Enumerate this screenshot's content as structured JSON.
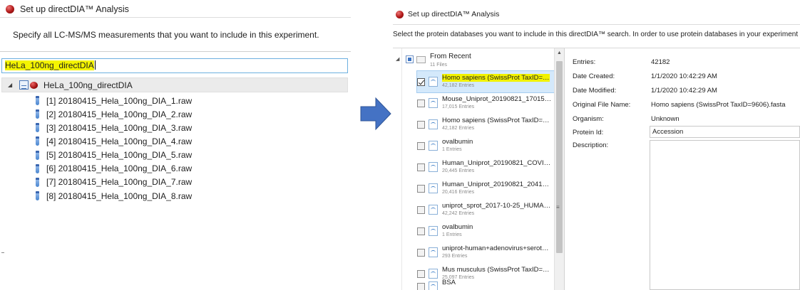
{
  "left": {
    "title": "Set up directDIA™ Analysis",
    "instruction": "Specify all LC-MS/MS measurements that you want to include in this experiment.",
    "experiment_name": "HeLa_100ng_directDIA",
    "tree_root": "HeLa_100ng_directDIA",
    "files": [
      "[1] 20180415_Hela_100ng_DIA_1.raw",
      "[2] 20180415_Hela_100ng_DIA_2.raw",
      "[3] 20180415_Hela_100ng_DIA_3.raw",
      "[4] 20180415_Hela_100ng_DIA_4.raw",
      "[5] 20180415_Hela_100ng_DIA_5.raw",
      "[6] 20180415_Hela_100ng_DIA_6.raw",
      "[7] 20180415_Hela_100ng_DIA_7.raw",
      "[8] 20180415_Hela_100ng_DIA_8.raw"
    ]
  },
  "right": {
    "title": "Set up directDIA™ Analysis",
    "instruction": "Select the protein databases you want to include in this directDIA™ search. In order to use protein databases in your experiment you need",
    "group": {
      "label": "From Recent",
      "count": "11 Files"
    },
    "databases": [
      {
        "name": "Homo sapiens (SwissProt TaxID=…",
        "entries": "42,182 Entries",
        "checked": true,
        "selected": true
      },
      {
        "name": "Mouse_Uniprot_20190821_17015…",
        "entries": "17,015 Entries",
        "checked": false,
        "selected": false
      },
      {
        "name": "Homo sapiens (SwissProt TaxID=…",
        "entries": "42,182 Entries",
        "checked": false,
        "selected": false
      },
      {
        "name": "ovalbumin",
        "entries": "1 Entries",
        "checked": false,
        "selected": false
      },
      {
        "name": "Human_Uniprot_20190821_COVI…",
        "entries": "20,445 Entries",
        "checked": false,
        "selected": false
      },
      {
        "name": "Human_Uniprot_20190821_2041…",
        "entries": "20,416 Entries",
        "checked": false,
        "selected": false
      },
      {
        "name": "uniprot_sprot_2017-10-25_HUMA…",
        "entries": "42,242 Entries",
        "checked": false,
        "selected": false
      },
      {
        "name": "ovalbumin",
        "entries": "1 Entries",
        "checked": false,
        "selected": false
      },
      {
        "name": "uniprot-human+adenovirus+serot…",
        "entries": "293 Entries",
        "checked": false,
        "selected": false
      },
      {
        "name": "Mus musculus (SwissProt TaxID=…",
        "entries": "25,097 Entries",
        "checked": false,
        "selected": false
      },
      {
        "name": "BSA",
        "entries": "",
        "checked": false,
        "selected": false
      }
    ],
    "details": {
      "entries_label": "Entries:",
      "entries_value": "42182",
      "created_label": "Date Created:",
      "created_value": "1/1/2020 10:42:29 AM",
      "modified_label": "Date Modified:",
      "modified_value": "1/1/2020 10:42:29 AM",
      "original_label": "Original File Name:",
      "original_value": "Homo sapiens (SwissProt TaxID=9606).fasta",
      "organism_label": "Organism:",
      "organism_value": "Unknown",
      "protein_id_label": "Protein Id:",
      "protein_id_value": "Accession",
      "description_label": "Description:"
    }
  },
  "colors": {
    "highlight": "#f4f400",
    "arrow": "#4472c4",
    "selection": "#d4e9fb"
  }
}
